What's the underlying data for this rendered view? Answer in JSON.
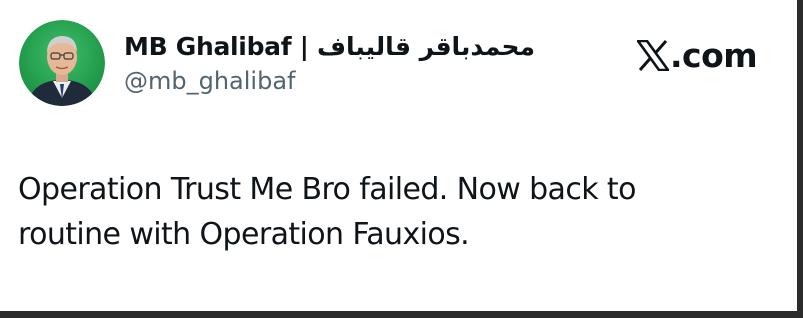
{
  "author": {
    "display_name": "MB Ghalibaf | محمدباقر قالیباف",
    "handle": "@mb_ghalibaf",
    "avatar_icon": "profile-photo"
  },
  "brand": {
    "logo_icon": "x-logo-icon",
    "domain_suffix": ".com"
  },
  "tweet": {
    "text": "Operation Trust Me Bro failed. Now back to routine with Operation Fauxios."
  },
  "colors": {
    "text": "#0f1419",
    "secondary_text": "#536471",
    "avatar_ring": "#1a9c4a"
  }
}
